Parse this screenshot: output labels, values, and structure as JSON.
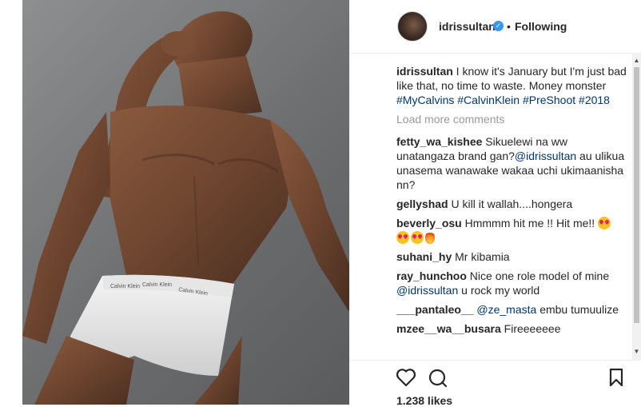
{
  "post": {
    "username": "idrissultan",
    "follow_status": "Following",
    "separator": "•",
    "verified_mark": "✓",
    "photo_description_icon": "photo",
    "likes": "1.238 likes"
  },
  "caption": {
    "username": "idrissultan",
    "text": " I know it's January but I'm just bad like that, no time to waste. Money monster ",
    "hashtags": [
      "#MyCalvins",
      "#CalvinKlein",
      "#PreShoot",
      "#2018"
    ]
  },
  "load_more": "Load more comments",
  "comments": [
    {
      "user": "fetty_wa_kishee",
      "pre": " Sikuelewi na ww unatangaza brand gan?",
      "mention": "@idrissultan",
      "post": " au ulikua unasema wanawake wakaa uchi ukimaanisha nn?"
    },
    {
      "user": "gellyshad",
      "pre": " U kill it wallah....hongera",
      "mention": "",
      "post": ""
    },
    {
      "user": "beverly_osu",
      "pre": " Hmmmm hit me !! Hit me!! ",
      "mention": "",
      "post": ""
    },
    {
      "user": "suhani_hy",
      "pre": " Mr kibamia",
      "mention": "",
      "post": ""
    },
    {
      "user": "ray_hunchoo",
      "pre": " Nice one role model of mine ",
      "mention": "@idrissultan",
      "post": " u rock my world"
    },
    {
      "user": "___pantaleo__",
      "pre": " ",
      "mention": "@ze_masta",
      "post": " embu tumuulize"
    },
    {
      "user": "mzee__wa__busara",
      "pre": " Fireeeeeee",
      "mention": "",
      "post": ""
    }
  ],
  "icons": {
    "like": "heart-icon",
    "comment": "comment-icon",
    "save": "bookmark-icon"
  },
  "colors": {
    "link": "#003569",
    "verified": "#3897f0",
    "muted": "#999999",
    "text": "#262626"
  },
  "photo_print": {
    "waistband_left": "Calvin Klein",
    "waistband_mid": "Calvin Klein",
    "waistband_right": "Calvin Klein"
  }
}
